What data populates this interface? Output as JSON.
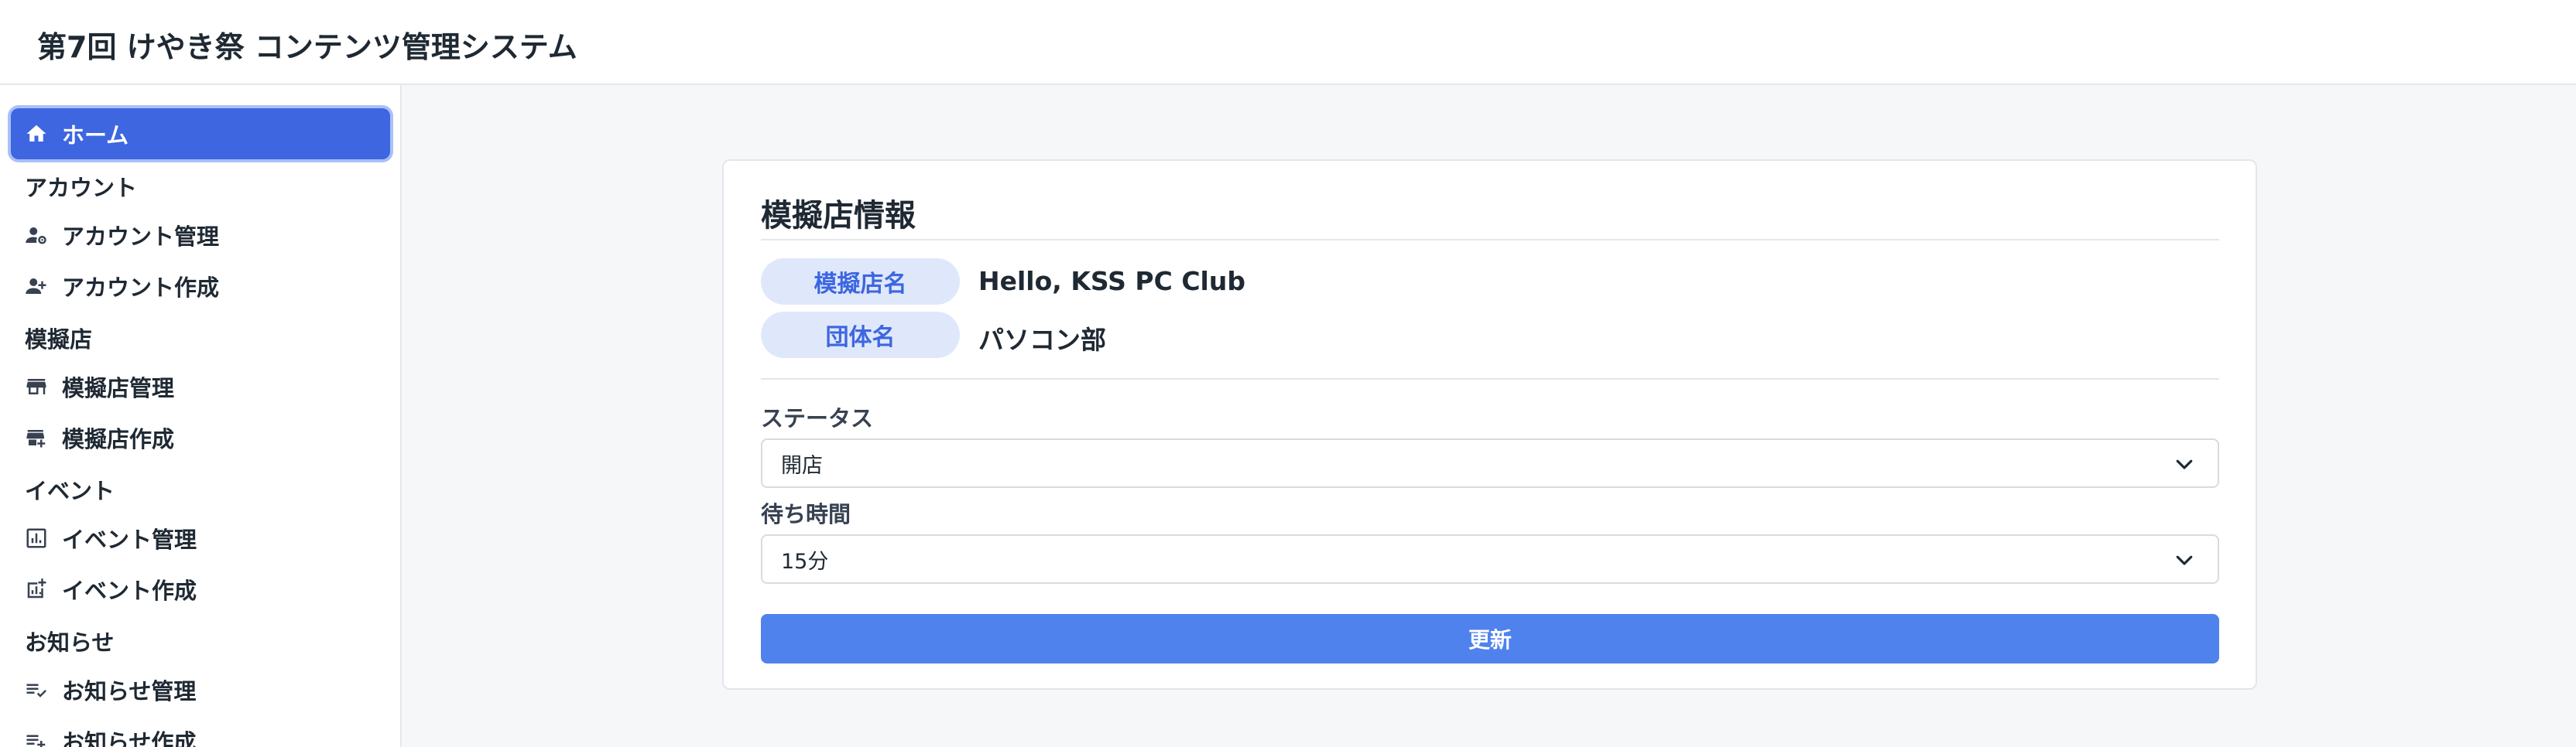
{
  "header": {
    "title": "第7回 けやき祭 コンテンツ管理システム"
  },
  "sidebar": {
    "home": "ホーム",
    "sections": {
      "account": "アカウント",
      "shop": "模擬店",
      "event": "イベント",
      "news": "お知らせ"
    },
    "items": {
      "account_manage": "アカウント管理",
      "account_create": "アカウント作成",
      "shop_manage": "模擬店管理",
      "shop_create": "模擬店作成",
      "event_manage": "イベント管理",
      "event_create": "イベント作成",
      "news_manage": "お知らせ管理",
      "news_create": "お知らせ作成"
    },
    "icons": [
      "home-icon",
      "account-manage-icon",
      "account-add-icon",
      "store-icon",
      "store-add-icon",
      "chart-icon",
      "chart-add-icon",
      "list-check-icon",
      "list-add-icon"
    ]
  },
  "card": {
    "title": "模擬店情報",
    "shop_name_label": "模擬店名",
    "shop_name_value": "Hello, KSS PC Club",
    "group_label": "団体名",
    "group_value": "パソコン部",
    "status_label": "ステータス",
    "status_value": "開店",
    "wait_label": "待ち時間",
    "wait_value": "15分",
    "update_button": "更新"
  },
  "colors": {
    "accent": "#3d66e0",
    "button": "#4f82ec",
    "pill_bg": "#dfe8fb"
  }
}
